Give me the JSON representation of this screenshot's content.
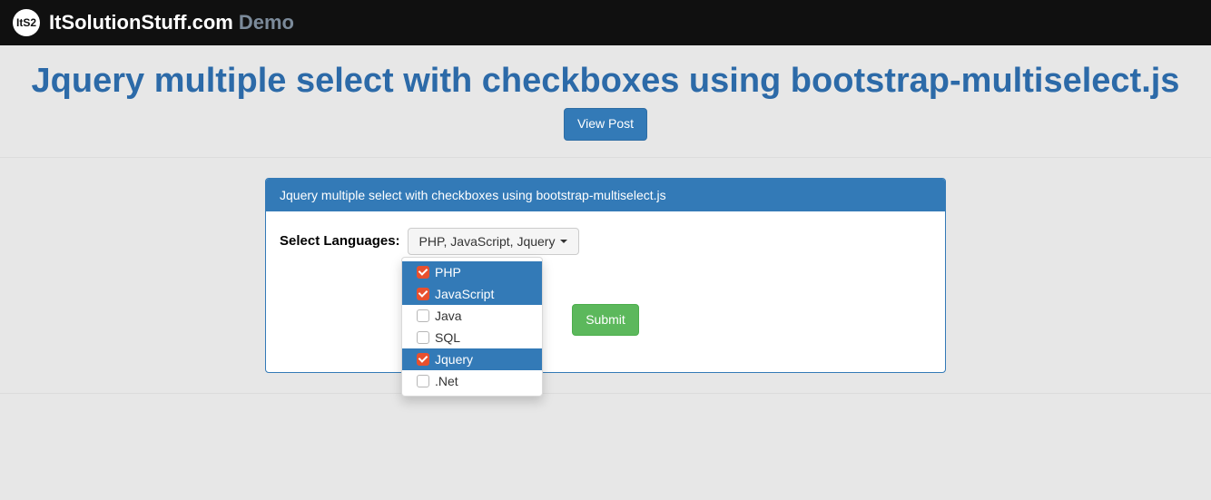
{
  "navbar": {
    "logo_text": "ItS2",
    "brand": "ItSolutionStuff.com",
    "demo_label": "Demo"
  },
  "page_title": "Jquery multiple select with checkboxes using bootstrap-multiselect.js",
  "view_post_label": "View Post",
  "panel": {
    "heading": "Jquery multiple select with checkboxes using bootstrap-multiselect.js",
    "form_label": "Select Languages:",
    "select_button_text": "PHP, JavaScript, Jquery",
    "options": [
      {
        "label": "PHP",
        "checked": true
      },
      {
        "label": "JavaScript",
        "checked": true
      },
      {
        "label": "Java",
        "checked": false
      },
      {
        "label": "SQL",
        "checked": false
      },
      {
        "label": "Jquery",
        "checked": true
      },
      {
        "label": ".Net",
        "checked": false
      }
    ],
    "submit_label": "Submit"
  }
}
